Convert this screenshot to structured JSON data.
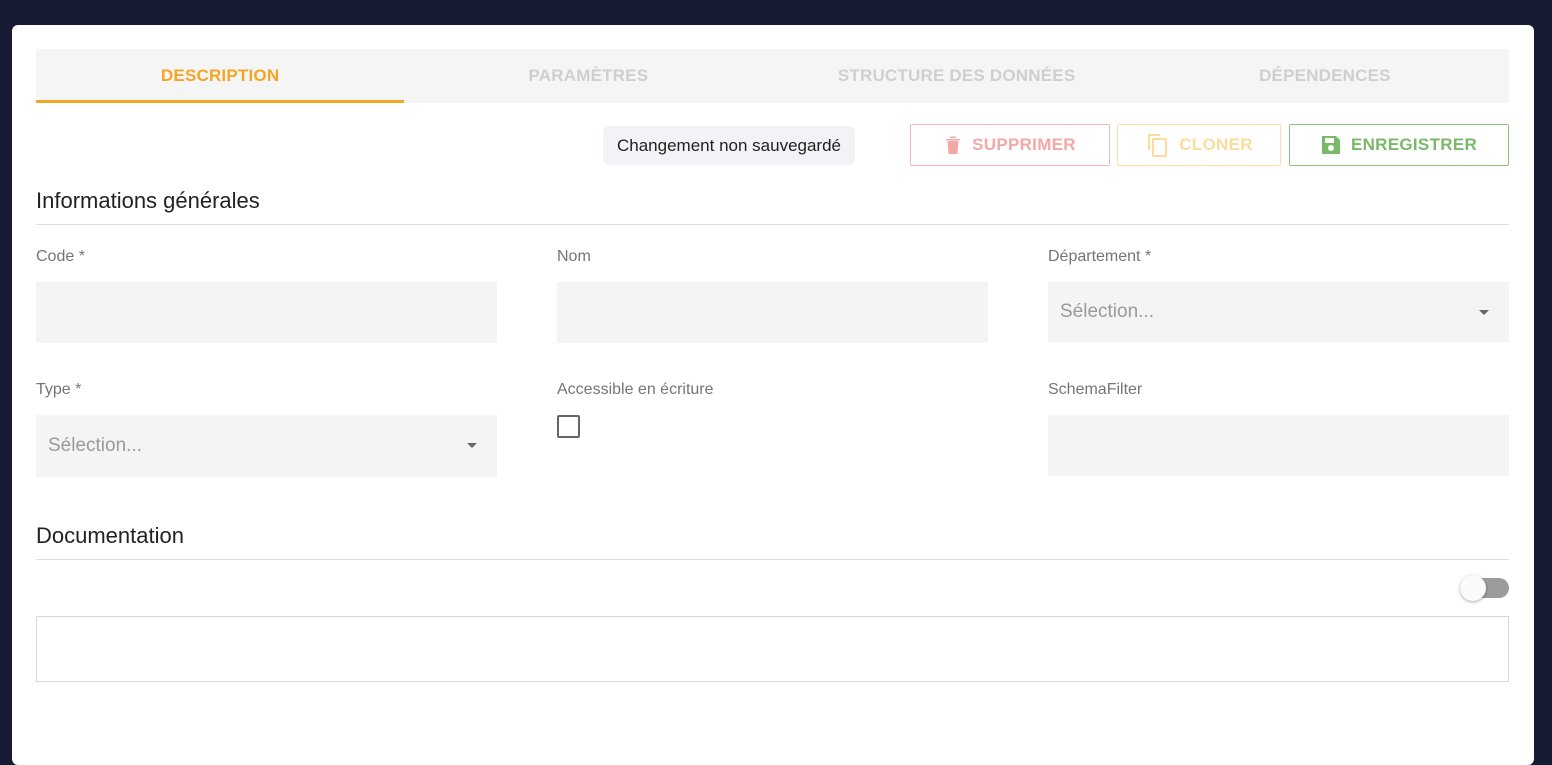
{
  "tabs": [
    {
      "label": "DESCRIPTION",
      "active": true
    },
    {
      "label": "PARAMÈTRES",
      "active": false
    },
    {
      "label": "STRUCTURE DES DONNÉES",
      "active": false
    },
    {
      "label": "DÉPENDENCES",
      "active": false
    }
  ],
  "toolbar": {
    "unsaved_label": "Changement non sauvegardé",
    "delete_label": "SUPPRIMER",
    "clone_label": "CLONER",
    "save_label": "ENREGISTRER"
  },
  "general": {
    "title": "Informations générales",
    "code_label": "Code *",
    "code_value": "",
    "name_label": "Nom",
    "name_value": "",
    "department_label": "Département *",
    "department_value": "Sélection...",
    "type_label": "Type *",
    "type_value": "Sélection...",
    "writable_label": "Accessible en écriture",
    "writable_checked": false,
    "schema_filter_label": "SchemaFilter",
    "schema_filter_value": ""
  },
  "documentation": {
    "title": "Documentation",
    "toggle_on": false,
    "content": ""
  },
  "colors": {
    "accent": "#f5a524",
    "delete": "#f4a7a7",
    "clone": "#fbdc9c",
    "save": "#7ab86a",
    "background": "#161b33"
  },
  "icons": {
    "delete": "trash-icon",
    "clone": "copy-icon",
    "save": "floppy-icon",
    "select_caret": "caret-down-icon"
  }
}
